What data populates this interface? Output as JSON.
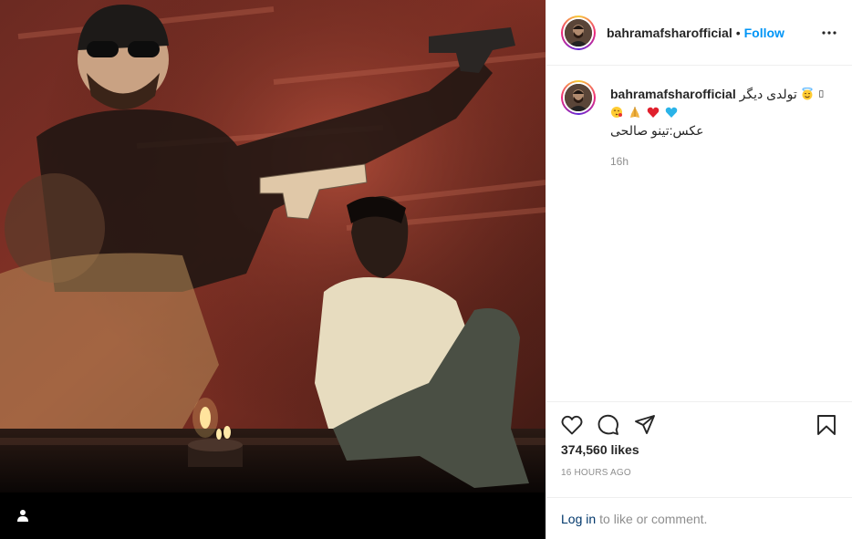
{
  "header": {
    "username": "bahramafsharofficial",
    "separator": "•",
    "follow_label": "Follow"
  },
  "caption": {
    "username": "bahramafsharofficial",
    "text": "تولدی دیگر",
    "emojis": [
      "smiling-face-with-halo",
      "face-blowing-kiss",
      "folded-hands",
      "red-heart",
      "blue-heart"
    ],
    "line2": "عکس:تینو صالحی",
    "time": "16h"
  },
  "post": {
    "likes": "374,560 likes",
    "time_ago": "16 HOURS AGO"
  },
  "comment_bar": {
    "login_label": "Log in",
    "rest_text": "to like or comment."
  },
  "colors": {
    "follow_blue": "#0095f6",
    "muted_gray": "#8e8e8e",
    "link_dark_blue": "#00376b"
  }
}
